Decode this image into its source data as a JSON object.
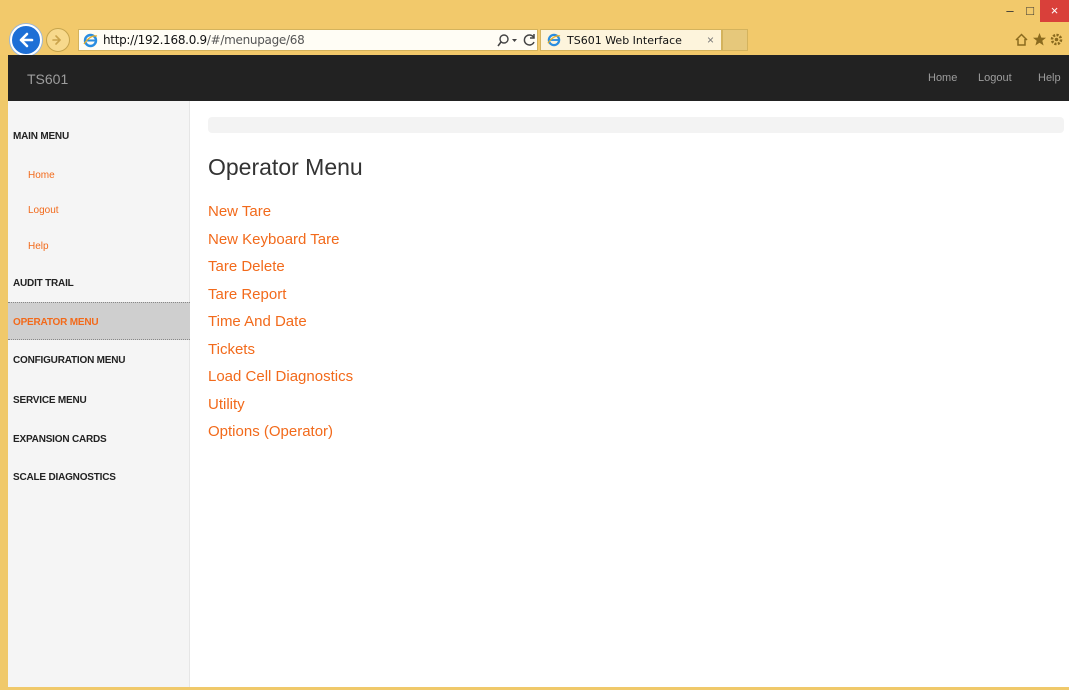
{
  "browser": {
    "url_host": "http://192.168.0.9",
    "url_path": "/#/menupage/68",
    "tab_title": "TS601 Web Interface",
    "tab_close": "×",
    "win_min": "–",
    "win_max": "□",
    "win_close": "×",
    "icons": [
      "back-icon",
      "forward-icon",
      "ie-logo-icon",
      "search-icon",
      "refresh-icon",
      "home-icon",
      "favorites-star-icon",
      "settings-gear-icon"
    ]
  },
  "navbar": {
    "brand": "TS601",
    "links": [
      "Home",
      "Logout",
      "Help"
    ]
  },
  "sidebar": {
    "items": [
      {
        "label": "MAIN MENU",
        "kind": "header"
      },
      {
        "label": "Home",
        "kind": "sub"
      },
      {
        "label": "Logout",
        "kind": "sub"
      },
      {
        "label": "Help",
        "kind": "sub"
      },
      {
        "label": "AUDIT TRAIL",
        "kind": "header"
      },
      {
        "label": "OPERATOR MENU",
        "kind": "header",
        "active": true
      },
      {
        "label": "CONFIGURATION MENU",
        "kind": "header"
      },
      {
        "label": "SERVICE MENU",
        "kind": "header"
      },
      {
        "label": "EXPANSION CARDS",
        "kind": "header"
      },
      {
        "label": "SCALE DIAGNOSTICS",
        "kind": "header"
      }
    ]
  },
  "main": {
    "title": "Operator Menu",
    "links": [
      "New Tare",
      "New Keyboard Tare",
      "Tare Delete",
      "Tare Report",
      "Time And Date",
      "Tickets",
      "Load Cell Diagnostics",
      "Utility",
      "Options (Operator)"
    ]
  },
  "colors": {
    "accent": "#f26a1b",
    "navbar_bg": "#222222",
    "chrome_bg": "#f2c96b",
    "sidebar_bg": "#f5f5f5",
    "active_bg": "#cfcfcf"
  }
}
